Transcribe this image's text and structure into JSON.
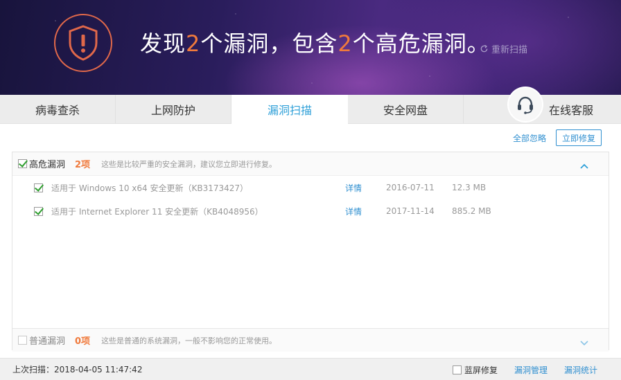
{
  "header": {
    "headline_parts": [
      "发现",
      "2",
      "个漏洞，包含",
      "2",
      "个高危漏洞。"
    ],
    "rescan_label": "重新扫描"
  },
  "tabs": [
    {
      "label": "病毒查杀"
    },
    {
      "label": "上网防护"
    },
    {
      "label": "漏洞扫描",
      "active": true
    },
    {
      "label": "安全网盘"
    }
  ],
  "support": {
    "label": "在线客服"
  },
  "actions": {
    "ignore_all": "全部忽略",
    "fix_now": "立即修复"
  },
  "high_group": {
    "title": "高危漏洞",
    "count": "2项",
    "desc": "这些是比较严重的安全漏洞，建议您立即进行修复。",
    "checked": true,
    "items": [
      {
        "title": "适用于 Windows 10 x64 安全更新（KB3173427）",
        "detail": "详情",
        "date": "2016-07-11",
        "size": "12.3 MB",
        "checked": true
      },
      {
        "title": "适用于 Internet Explorer 11 安全更新（KB4048956）",
        "detail": "详情",
        "date": "2017-11-14",
        "size": "885.2 MB",
        "checked": true
      }
    ]
  },
  "normal_group": {
    "title": "普通漏洞",
    "count": "0项",
    "desc": "这些是普通的系统漏洞，一般不影响您的正常使用。",
    "checked": false
  },
  "footer": {
    "last_scan": "上次扫描：2018-04-05 11:47:42",
    "bluescreen": "蓝屏修复",
    "manage": "漏洞管理",
    "stats": "漏洞统计"
  },
  "colors": {
    "accent": "#2fa0d8",
    "warning": "#f07a3c",
    "check": "#2e9e2e"
  }
}
